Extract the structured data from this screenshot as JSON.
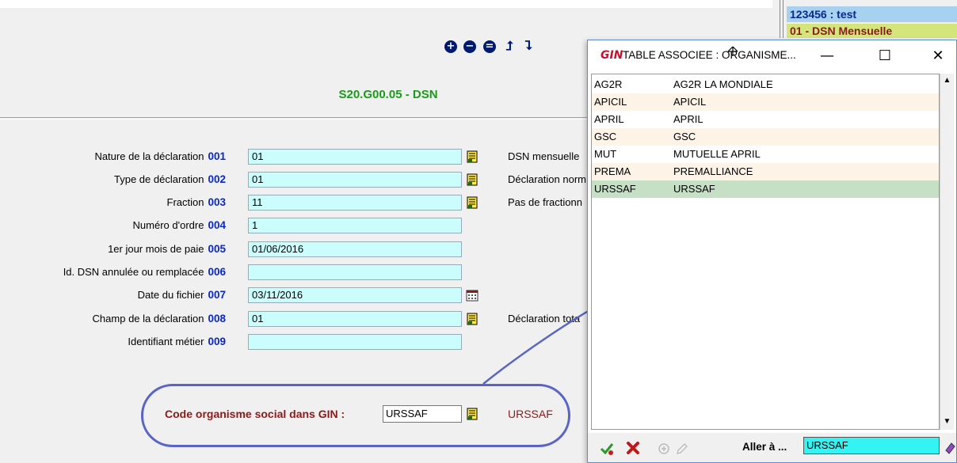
{
  "form": {
    "title": "S20.G00.05 - DSN",
    "fields": [
      {
        "label": "Nature de la déclaration",
        "code": "001",
        "value": "01",
        "description": "DSN mensuelle",
        "lookup": "lookup-icon"
      },
      {
        "label": "Type de déclaration",
        "code": "002",
        "value": "01",
        "description": "Déclaration norm",
        "lookup": "lookup-icon"
      },
      {
        "label": "Fraction",
        "code": "003",
        "value": "11",
        "description": "Pas de fractionn",
        "lookup": "lookup-icon"
      },
      {
        "label": "Numéro d'ordre",
        "code": "004",
        "value": "1",
        "description": ""
      },
      {
        "label": "1er jour mois de paie",
        "code": "005",
        "value": "01/06/2016",
        "description": ""
      },
      {
        "label": "Id. DSN annulée ou remplacée",
        "code": "006",
        "value": "",
        "description": ""
      },
      {
        "label": "Date du fichier",
        "code": "007",
        "value": "03/11/2016",
        "description": "",
        "lookup": "calendar-icon"
      },
      {
        "label": "Champ de la déclaration",
        "code": "008",
        "value": "01",
        "description": "Déclaration tota",
        "lookup": "lookup-icon"
      },
      {
        "label": "Identifiant métier",
        "code": "009",
        "value": "",
        "description": ""
      }
    ],
    "code_organisme": {
      "label": "Code organisme social dans GIN :",
      "value": "URSSAF",
      "description": "URSSAF"
    }
  },
  "toolbar": {
    "icons": [
      "plus-circle-icon",
      "minus-circle-icon",
      "equal-circle-icon",
      "arrow-up-icon",
      "arrow-right-icon"
    ]
  },
  "background_panel": {
    "title": "123456 : test",
    "subtitle": "01 - DSN Mensuelle"
  },
  "popup": {
    "app_icon": "GIN",
    "title": "TABLE ASSOCIEE : ORGANISME...",
    "window_buttons": {
      "minimize": "—",
      "maximize": "☐",
      "close": "✕"
    },
    "rows": [
      {
        "code": "AG2R",
        "name": "AG2R LA MONDIALE"
      },
      {
        "code": "APICIL",
        "name": "APICIL"
      },
      {
        "code": "APRIL",
        "name": "APRIL"
      },
      {
        "code": "GSC",
        "name": "GSC"
      },
      {
        "code": "MUT",
        "name": "MUTUELLE APRIL"
      },
      {
        "code": "PREMA",
        "name": "PREMALLIANCE"
      },
      {
        "code": "URSSAF",
        "name": "URSSAF"
      }
    ],
    "selected_index": 6,
    "goto_label": "Aller à ...",
    "goto_value": "URSSAF"
  },
  "colors": {
    "accent_blue": "#0b28c4",
    "title_green": "#1b9a1b",
    "field_cyan": "#ccfdfd",
    "selected_row": "#c5e0c5",
    "annotation": "#5a64c6",
    "dark_red": "#8b1a1a"
  }
}
